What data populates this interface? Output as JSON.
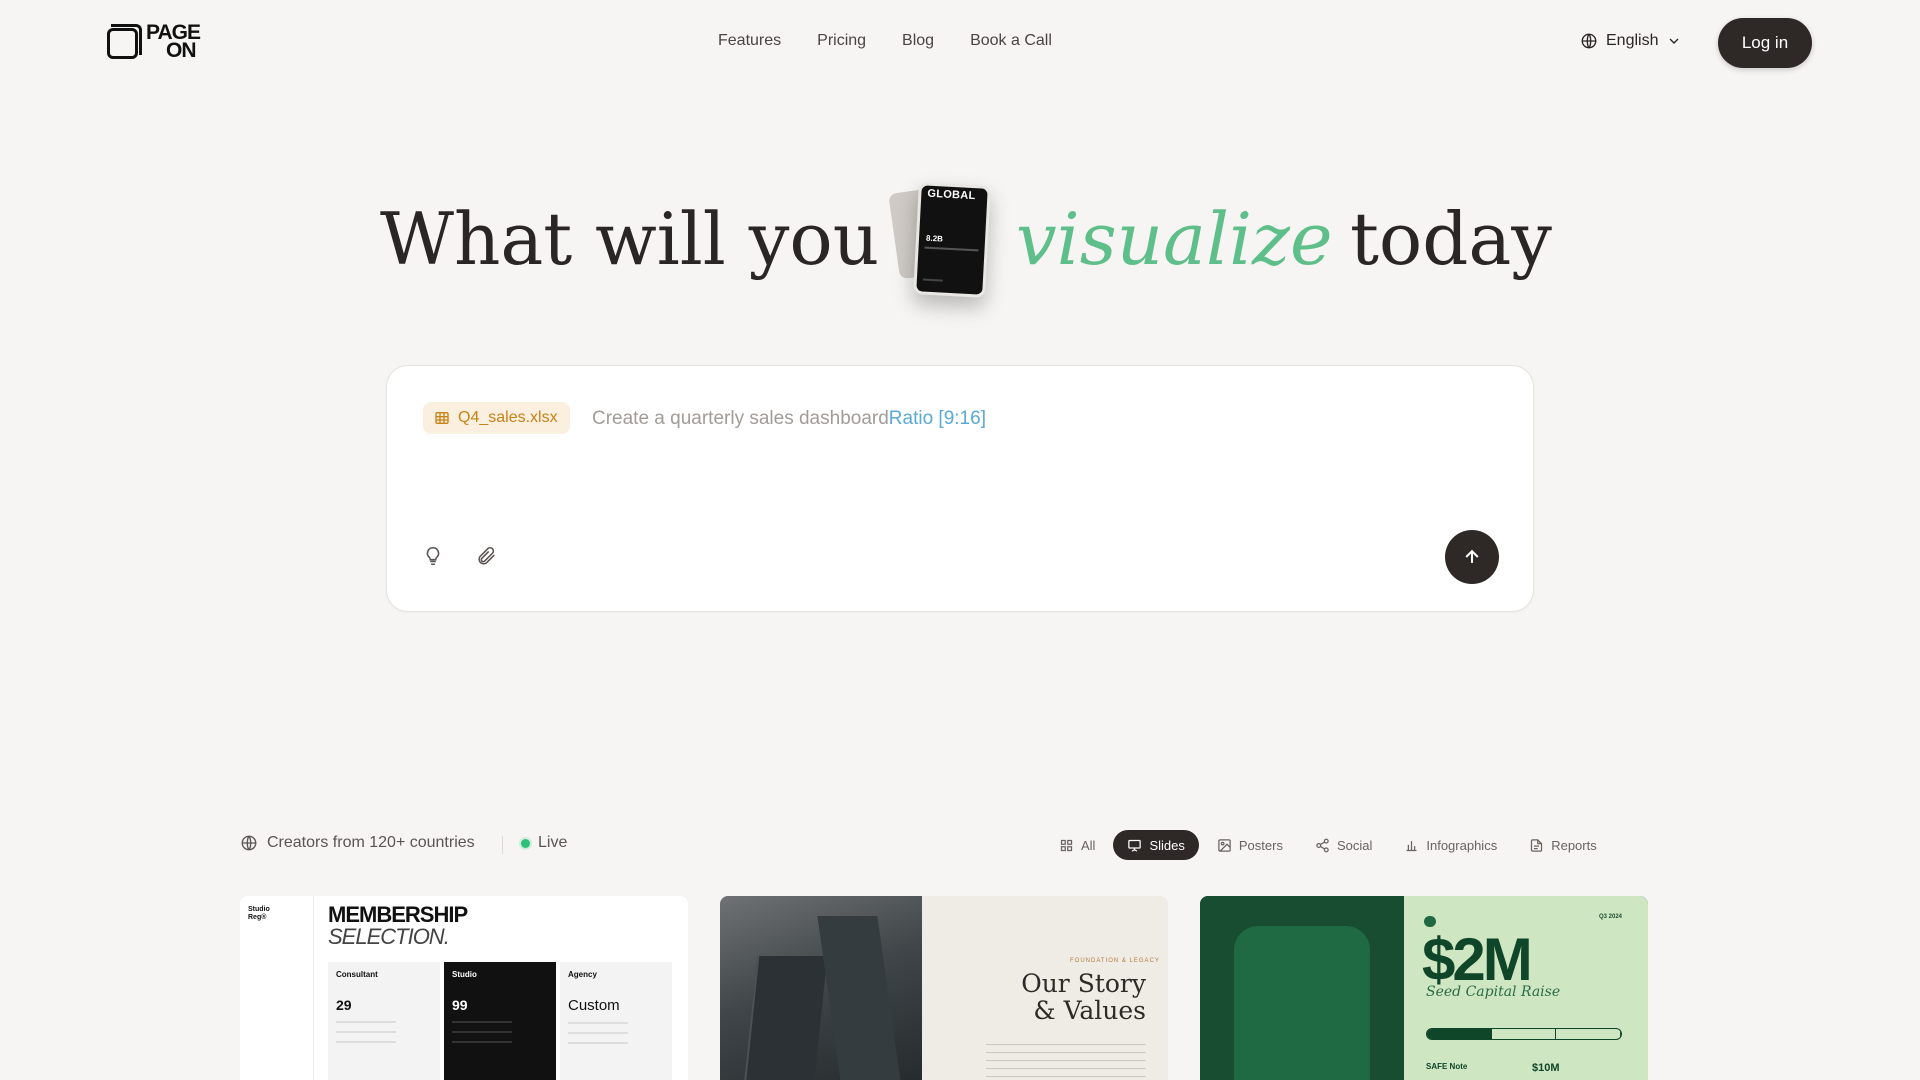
{
  "brand": {
    "logo_line1": "PAGE",
    "logo_line2": "ON"
  },
  "nav": {
    "links": [
      "Features",
      "Pricing",
      "Blog",
      "Book a Call"
    ],
    "language": "English",
    "login_label": "Log in"
  },
  "hero": {
    "part1": "What will you",
    "highlight": "visualize",
    "part2": "today",
    "phone_title": "GLOBAL",
    "phone_value": "8.2B"
  },
  "prompt": {
    "file_name": "Q4_sales.xlsx",
    "text": "Create a quarterly sales dashboard",
    "ratio": "Ratio [9:16]"
  },
  "gallery": {
    "creators_text": "Creators from 120+ countries",
    "live_label": "Live",
    "filters": [
      {
        "label": "All",
        "icon": "grid-icon"
      },
      {
        "label": "Slides",
        "icon": "presentation-icon"
      },
      {
        "label": "Posters",
        "icon": "image-icon"
      },
      {
        "label": "Social",
        "icon": "share-icon"
      },
      {
        "label": "Infographics",
        "icon": "bar-chart-icon"
      },
      {
        "label": "Reports",
        "icon": "document-icon"
      }
    ],
    "active_filter": "Slides"
  },
  "cards": {
    "membership": {
      "studio": "Studio",
      "studio_sub": "Reg®",
      "title": "MEMBERSHIP",
      "subtitle": "SELECTION.",
      "plans": [
        {
          "name": "Consultant",
          "price": "29"
        },
        {
          "name": "Studio",
          "price": "99"
        },
        {
          "name": "Agency",
          "price": "Custom"
        }
      ]
    },
    "story": {
      "kicker": "FOUNDATION & LEGACY",
      "title_line1": "Our Story",
      "title_line2": "& Values"
    },
    "seed": {
      "year": "Q3 2024",
      "amount": "$2M",
      "subtitle": "Seed Capital Raise",
      "instrument": "SAFE Note",
      "valuation": "$10M"
    }
  },
  "colors": {
    "background": "#f6f5f3",
    "dark": "#2e2826",
    "accent_green": "#5fbf8a",
    "ratio_blue": "#5aa9d8",
    "file_chip_text": "#c88216",
    "live_green": "#2fbf78"
  }
}
